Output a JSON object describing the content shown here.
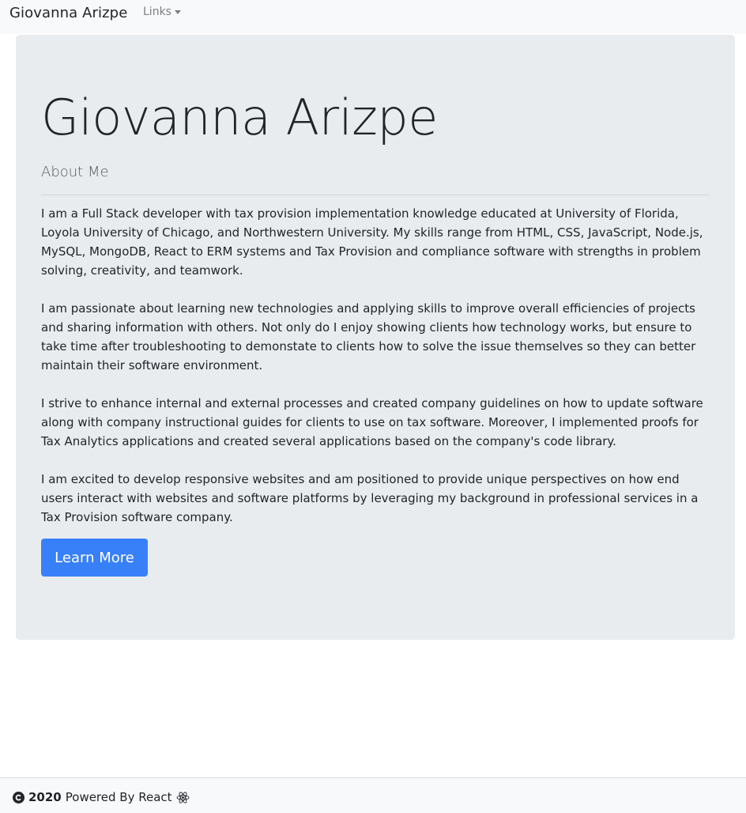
{
  "navbar": {
    "brand": "Giovanna Arizpe",
    "dropdown_label": "Links"
  },
  "jumbotron": {
    "title": "Giovanna Arizpe",
    "subtitle": "About Me",
    "paragraphs": [
      "I am a Full Stack developer with tax provision implementation knowledge educated at University of Florida, Loyola University of Chicago, and Northwestern University. My skills range from HTML, CSS, JavaScript, Node.js, MySQL, MongoDB, React to ERM systems and Tax Provision and compliance software with strengths in problem solving, creativity, and teamwork.",
      "I am passionate about learning new technologies and applying skills to improve overall efficiencies of projects and sharing information with others. Not only do I enjoy showing clients how technology works, but ensure to take time after troubleshooting to demonstate to clients how to solve the issue themselves so they can better maintain their software environment.",
      "I strive to enhance internal and external processes and created company guidelines on how to update software along with company instructional guides for clients to use on tax software. Moreover, I implemented proofs for Tax Analytics applications and created several applications based on the company's code library.",
      "I am excited to develop responsive websites and am positioned to provide unique perspectives on how end users interact with websites and software platforms by leveraging my background in professional services in a Tax Provision software company."
    ],
    "button_label": "Learn More"
  },
  "footer": {
    "year": "2020",
    "text": "Powered By React",
    "icons": [
      "copyright-icon",
      "react-icon"
    ]
  },
  "colors": {
    "navbar_bg": "#f8f9fa",
    "jumbotron_bg": "#e9ecef",
    "button_bg": "#3880f8",
    "text": "#212529"
  }
}
